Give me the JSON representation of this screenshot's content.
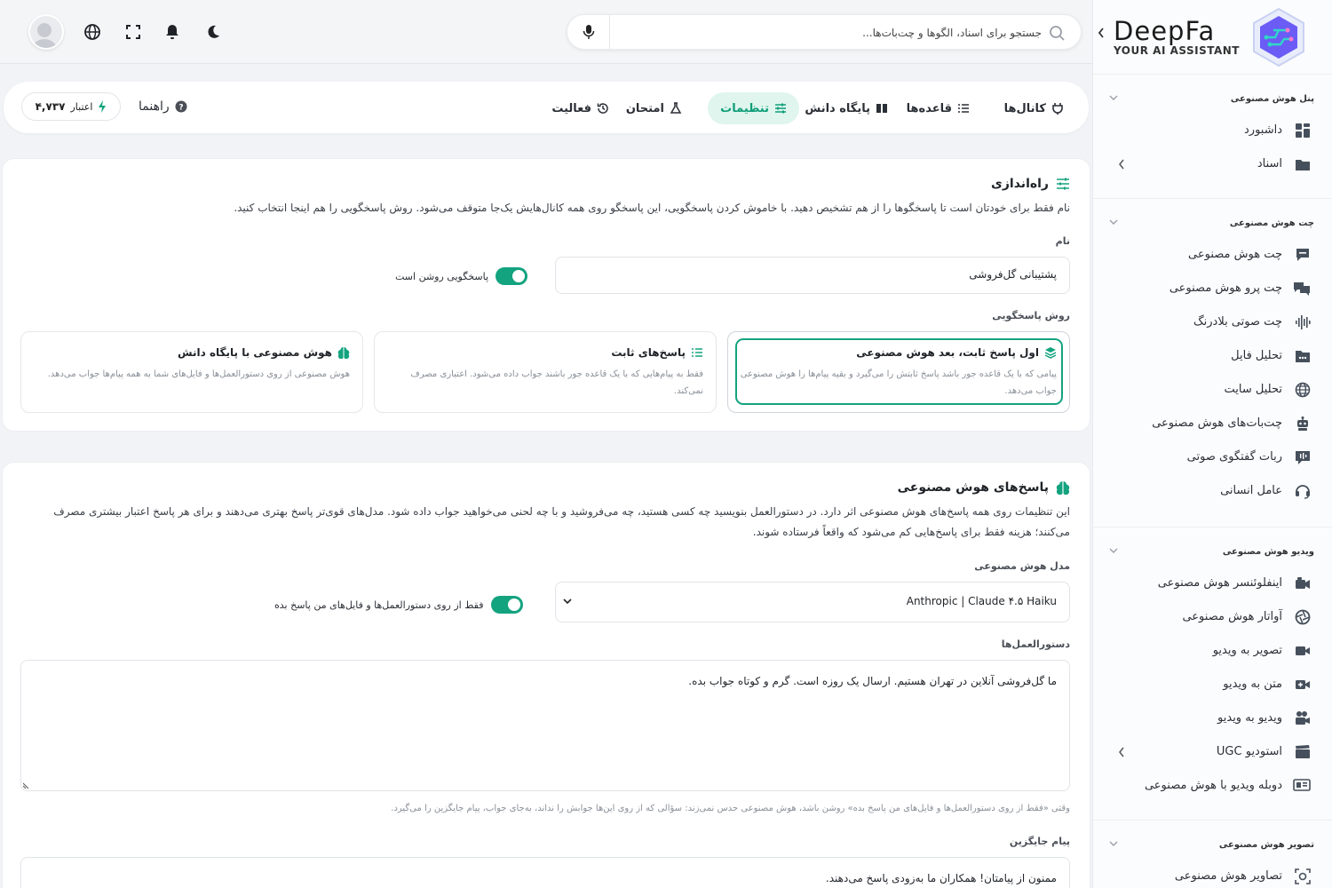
{
  "brand": {
    "name": "DeepFa",
    "tagline": "YOUR AI ASSISTANT"
  },
  "search": {
    "placeholder": "جستجو برای اسناد، الگوها و چت‌بات‌ها..."
  },
  "sidebar": {
    "sections": [
      {
        "title": "پنل هوش مصنوعی",
        "items": [
          {
            "label": "داشبورد",
            "icon": "dashboard-icon"
          },
          {
            "label": "اسناد",
            "icon": "folder-icon",
            "arrow": true
          }
        ]
      },
      {
        "title": "چت هوش مصنوعی",
        "items": [
          {
            "label": "چت هوش مصنوعی",
            "icon": "chat-icon"
          },
          {
            "label": "چت پرو هوش مصنوعی",
            "icon": "chat-pro-icon"
          },
          {
            "label": "چت صوتی بلادرنگ",
            "icon": "waveform-icon"
          },
          {
            "label": "تحلیل فایل",
            "icon": "file-analysis-icon"
          },
          {
            "label": "تحلیل سایت",
            "icon": "globe-icon"
          },
          {
            "label": "چت‌بات‌های هوش مصنوعی",
            "icon": "robot-icon"
          },
          {
            "label": "ربات گفتگوی صوتی",
            "icon": "voice-bot-icon"
          },
          {
            "label": "عامل انسانی",
            "icon": "headset-icon"
          }
        ]
      },
      {
        "title": "ویدیو هوش مصنوعی",
        "items": [
          {
            "label": "اینفلوئنسر هوش مصنوعی",
            "icon": "influencer-icon"
          },
          {
            "label": "آواتار هوش مصنوعی",
            "icon": "avatar-icon"
          },
          {
            "label": "تصویر به ویدیو",
            "icon": "video-camera-icon"
          },
          {
            "label": "متن به ویدیو",
            "icon": "text-video-icon"
          },
          {
            "label": "ویدیو به ویدیو",
            "icon": "video-video-icon"
          },
          {
            "label": "استودیو UGC",
            "icon": "studio-icon",
            "arrow": true
          },
          {
            "label": "دوبله ویدیو با هوش مصنوعی",
            "icon": "dub-icon"
          }
        ]
      },
      {
        "title": "تصویر هوش مصنوعی",
        "items": [
          {
            "label": "تصاویر هوش مصنوعی",
            "icon": "image-icon"
          }
        ]
      }
    ]
  },
  "tabs": [
    {
      "label": "کانال‌ها",
      "icon": "plug-icon"
    },
    {
      "label": "قاعده‌ها",
      "icon": "list-icon"
    },
    {
      "label": "پایگاه دانش",
      "icon": "book-icon"
    },
    {
      "label": "تنظیمات",
      "icon": "sliders-icon",
      "active": true
    },
    {
      "label": "امتحان",
      "icon": "flask-icon"
    },
    {
      "label": "فعالیت",
      "icon": "history-icon"
    }
  ],
  "header": {
    "help": "راهنما",
    "credit_label": "اعتبار",
    "credit_value": "۴,۷۳۷"
  },
  "setup": {
    "title": "راه‌اندازی",
    "desc": "نام فقط برای خودتان است تا پاسخگوها را از هم تشخیص دهید. با خاموش کردن پاسخگویی، این پاسخگو روی همه کانال‌هایش یک‌جا متوقف می‌شود. روش پاسخگویی را هم اینجا انتخاب کنید.",
    "name_label": "نام",
    "name_value": "پشتیبانی گل‌فروشی",
    "toggle_label": "پاسخگویی روشن است",
    "mode_label": "روش پاسخگویی",
    "modes": [
      {
        "title": "اول پاسخ ثابت، بعد هوش مصنوعی",
        "desc": "پیامی که با یک قاعده جور باشد پاسخ ثابتش را می‌گیرد و بقیه پیام‌ها را هوش مصنوعی جواب می‌دهد.",
        "selected": true
      },
      {
        "title": "پاسخ‌های ثابت",
        "desc": "فقط به پیام‌هایی که با یک قاعده جور باشند جواب داده می‌شود. اعتباری مصرف نمی‌کند."
      },
      {
        "title": "هوش مصنوعی با پایگاه دانش",
        "desc": "هوش مصنوعی از روی دستورالعمل‌ها و فایل‌های شما به همه پیام‌ها جواب می‌دهد."
      }
    ]
  },
  "ai": {
    "title": "پاسخ‌های هوش مصنوعی",
    "desc1": "این تنظیمات روی همه پاسخ‌های هوش مصنوعی اثر دارد. در دستورالعمل بنویسید چه کسی هستید، چه می‌فروشید و با چه لحنی می‌خواهید جواب داده شود. مدل‌های قوی‌تر پاسخ بهتری می‌دهند و برای هر پاسخ اعتبار بیشتری مصرف",
    "desc2": "می‌کنند؛ هزینه فقط برای پاسخ‌هایی کم می‌شود که واقعاً فرستاده شوند.",
    "model_label": "مدل هوش مصنوعی",
    "model_value": "Anthropic | Claude ۴.۵ Haiku",
    "only_toggle": "فقط از روی دستورالعمل‌ها و فایل‌های من پاسخ بده",
    "instr_label": "دستورالعمل‌ها",
    "instr_value": "ما گل‌فروشی آنلاین در تهران هستیم. ارسال یک روزه است. گرم و کوتاه جواب بده.",
    "hint": "وقتی «فقط از روی دستورالعمل‌ها و فایل‌های من پاسخ بده» روشن باشد، هوش مصنوعی حدس نمی‌زند: سؤالی که از روی این‌ها جوابش را نداند، به‌جای جواب، پیام جایگزین را می‌گیرد.",
    "fallback_label": "پیام جایگزین",
    "fallback_value": "ممنون از پیامتان! همکاران ما به‌زودی پاسخ می‌دهند."
  },
  "colors": {
    "accent": "#13a37f",
    "accent_bg": "#dff5ee"
  }
}
